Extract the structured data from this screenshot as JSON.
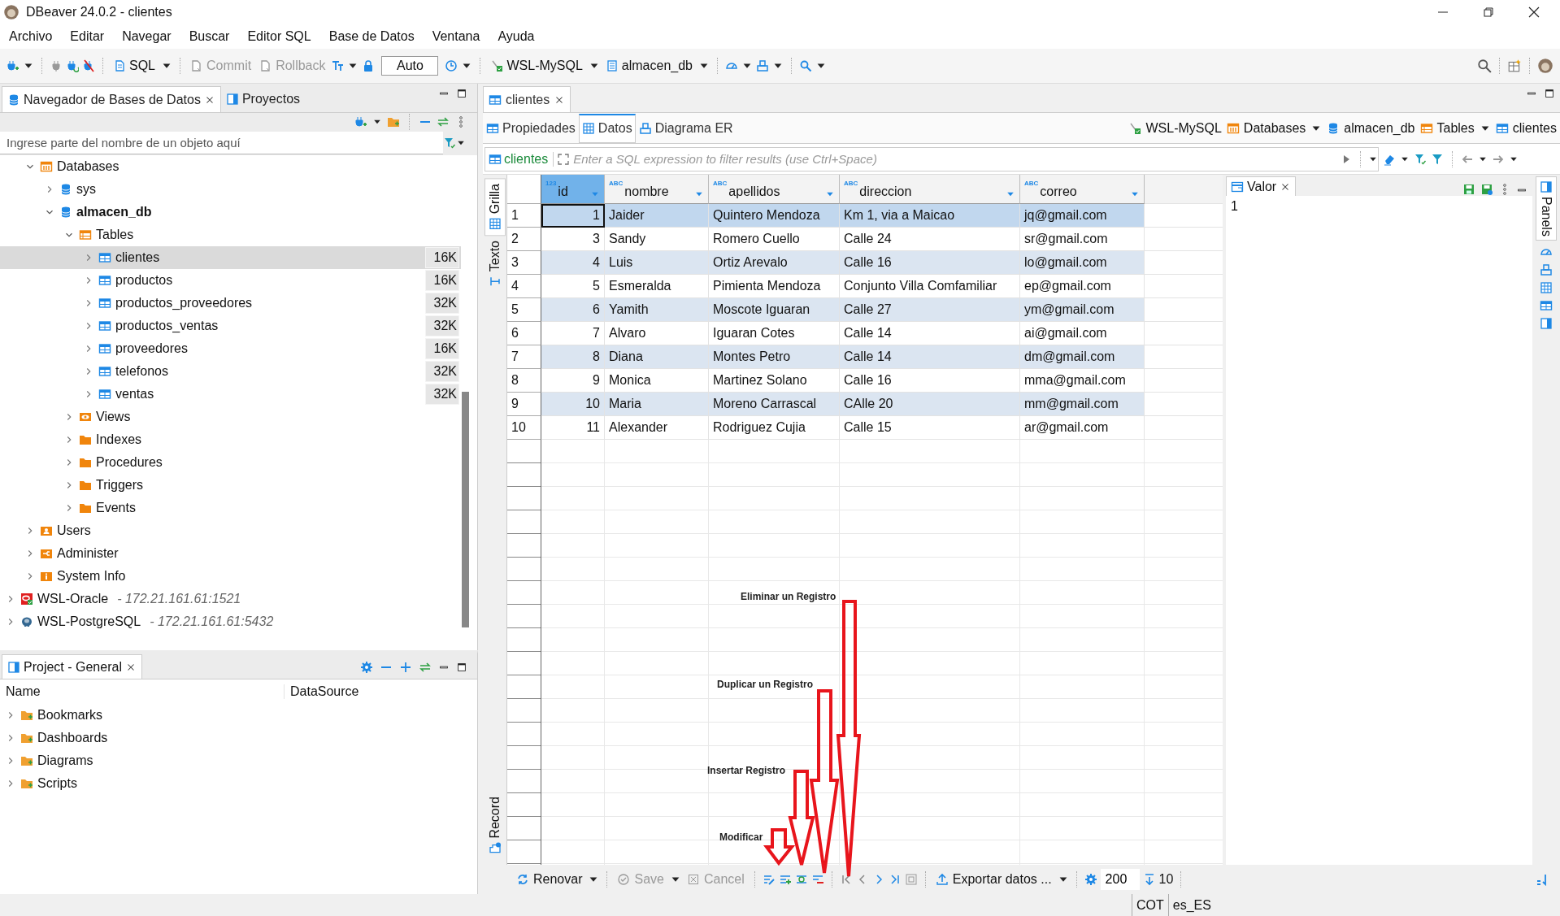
{
  "window": {
    "title": "DBeaver 24.0.2 - clientes"
  },
  "menu": [
    "Archivo",
    "Editar",
    "Navegar",
    "Buscar",
    "Editor SQL",
    "Base de Datos",
    "Ventana",
    "Ayuda"
  ],
  "toolbar": {
    "sql": {
      "label": "SQL",
      "disabled": false
    },
    "commit": {
      "label": "Commit",
      "disabled": true
    },
    "rollback": {
      "label": "Rollback",
      "disabled": true
    },
    "transaction_mode": "Auto",
    "connection": "WSL-MySQL",
    "database": "almacen_db"
  },
  "navigator": {
    "tabs": [
      {
        "label": "Navegador de Bases de Datos",
        "selected": true
      },
      {
        "label": "Proyectos",
        "selected": false
      }
    ],
    "filter_placeholder": "Ingrese parte del nombre de un objeto aquí",
    "tree": [
      {
        "label": "Databases",
        "kind": "databases",
        "expanded": true,
        "selected": false,
        "children": [
          {
            "label": "sys",
            "kind": "database",
            "expanded": false,
            "selected": false,
            "active": false
          },
          {
            "label": "almacen_db",
            "kind": "database",
            "expanded": true,
            "selected": false,
            "active": true,
            "children": [
              {
                "label": "Tables",
                "kind": "tables",
                "expanded": true,
                "selected": false,
                "children": [
                  {
                    "label": "clientes",
                    "kind": "table",
                    "expanded": false,
                    "selected": true,
                    "size": "16K"
                  },
                  {
                    "label": "productos",
                    "kind": "table",
                    "expanded": false,
                    "selected": false,
                    "size": "16K"
                  },
                  {
                    "label": "productos_proveedores",
                    "kind": "table",
                    "expanded": false,
                    "selected": false,
                    "size": "32K"
                  },
                  {
                    "label": "productos_ventas",
                    "kind": "table",
                    "expanded": false,
                    "selected": false,
                    "size": "32K"
                  },
                  {
                    "label": "proveedores",
                    "kind": "table",
                    "expanded": false,
                    "selected": false,
                    "size": "16K"
                  },
                  {
                    "label": "telefonos",
                    "kind": "table",
                    "expanded": false,
                    "selected": false,
                    "size": "32K"
                  },
                  {
                    "label": "ventas",
                    "kind": "table",
                    "expanded": false,
                    "selected": false,
                    "size": "32K"
                  }
                ]
              },
              {
                "label": "Views",
                "kind": "views",
                "expanded": false,
                "selected": false
              },
              {
                "label": "Indexes",
                "kind": "folder",
                "expanded": false,
                "selected": false
              },
              {
                "label": "Procedures",
                "kind": "folder",
                "expanded": false,
                "selected": false
              },
              {
                "label": "Triggers",
                "kind": "folder",
                "expanded": false,
                "selected": false
              },
              {
                "label": "Events",
                "kind": "folder",
                "expanded": false,
                "selected": false
              }
            ]
          }
        ]
      },
      {
        "label": "Users",
        "kind": "users",
        "expanded": false,
        "selected": false
      },
      {
        "label": "Administer",
        "kind": "admin",
        "expanded": false,
        "selected": false
      },
      {
        "label": "System Info",
        "kind": "info",
        "expanded": false,
        "selected": false
      }
    ],
    "connections": [
      {
        "label": "WSL-Oracle",
        "kind": "oracle",
        "expanded": false,
        "selected": false,
        "detail": "- 172.21.161.61:1521"
      },
      {
        "label": "WSL-PostgreSQL",
        "kind": "postgres",
        "expanded": false,
        "selected": false,
        "detail": "- 172.21.161.61:5432"
      }
    ]
  },
  "project": {
    "title": "Project - General",
    "columns": [
      "Name",
      "DataSource"
    ],
    "items": [
      {
        "label": "Bookmarks"
      },
      {
        "label": "Dashboards"
      },
      {
        "label": "Diagrams"
      },
      {
        "label": "Scripts"
      }
    ]
  },
  "editor": {
    "tabs": [
      {
        "label": "clientes",
        "selected": true
      }
    ],
    "subtabs": [
      {
        "label": "Propiedades",
        "selected": false
      },
      {
        "label": "Datos",
        "selected": true
      },
      {
        "label": "Diagrama ER",
        "selected": false
      }
    ],
    "breadcrumb": [
      {
        "label": "WSL-MySQL",
        "kind": "connection"
      },
      {
        "label": "Databases",
        "kind": "databases"
      },
      {
        "label": "almacen_db",
        "kind": "database"
      },
      {
        "label": "Tables",
        "kind": "tables"
      },
      {
        "label": "clientes",
        "kind": "table"
      }
    ],
    "filter": {
      "table": "clientes",
      "placeholder": "Enter a SQL expression to filter results (use Ctrl+Space)"
    },
    "view_tabs": [
      {
        "label": "Grilla",
        "selected": true
      },
      {
        "label": "Texto",
        "selected": false
      }
    ],
    "record_tab": "Record",
    "grid": {
      "columns": [
        {
          "name": "id",
          "type": "123"
        },
        {
          "name": "nombre",
          "type": "ABC"
        },
        {
          "name": "apellidos",
          "type": "ABC"
        },
        {
          "name": "direccion",
          "type": "ABC"
        },
        {
          "name": "correo",
          "type": "ABC"
        }
      ],
      "rows": [
        {
          "number": "1",
          "selected": true,
          "cells": [
            "1",
            "Jaider",
            "Quintero Mendoza",
            "Km 1, via a Maicao",
            "jq@gmail.com"
          ]
        },
        {
          "number": "2",
          "selected": false,
          "cells": [
            "3",
            "Sandy",
            "Romero Cuello",
            "Calle 24",
            "sr@gmail.com"
          ]
        },
        {
          "number": "3",
          "selected": false,
          "cells": [
            "4",
            "Luis",
            "Ortiz Arevalo",
            "Calle 16",
            "lo@gmail.com"
          ]
        },
        {
          "number": "4",
          "selected": false,
          "cells": [
            "5",
            "Esmeralda",
            "Pimienta Mendoza",
            "Conjunto Villa Comfamiliar",
            "ep@gmail.com"
          ]
        },
        {
          "number": "5",
          "selected": false,
          "cells": [
            "6",
            "Yamith",
            "Moscote Iguaran",
            "Calle 27",
            "ym@gmail.com"
          ]
        },
        {
          "number": "6",
          "selected": false,
          "cells": [
            "7",
            "Alvaro",
            "Iguaran Cotes",
            "Calle 14",
            "ai@gmail.com"
          ]
        },
        {
          "number": "7",
          "selected": false,
          "cells": [
            "8",
            "Diana",
            "Montes Petro",
            "Calle 14",
            "dm@gmail.com"
          ]
        },
        {
          "number": "8",
          "selected": false,
          "cells": [
            "9",
            "Monica",
            "Martinez Solano",
            "Calle 16",
            "mma@gmail.com"
          ]
        },
        {
          "number": "9",
          "selected": false,
          "cells": [
            "10",
            "Maria",
            "Moreno Carrascal",
            "CAlle 20",
            "mm@gmail.com"
          ]
        },
        {
          "number": "10",
          "selected": false,
          "cells": [
            "11",
            "Alexander",
            "Rodriguez Cujia",
            "Calle 15",
            "ar@gmail.com"
          ]
        }
      ]
    },
    "value_panel": {
      "title": "Valor",
      "value": "1"
    },
    "side_panel": "Panels",
    "bottom": {
      "refresh": "Renovar",
      "save": {
        "label": "Save",
        "disabled": true
      },
      "cancel": {
        "label": "Cancel",
        "disabled": true
      },
      "export": "Exportar datos ...",
      "fetch_size": "200",
      "row_count": "10"
    }
  },
  "annotations": [
    {
      "text": "Eliminar un Registro"
    },
    {
      "text": "Duplicar un Registro"
    },
    {
      "text": "Insertar Registro"
    },
    {
      "text": "Modificar"
    }
  ],
  "status_bar": [
    "COT",
    "es_ES"
  ]
}
